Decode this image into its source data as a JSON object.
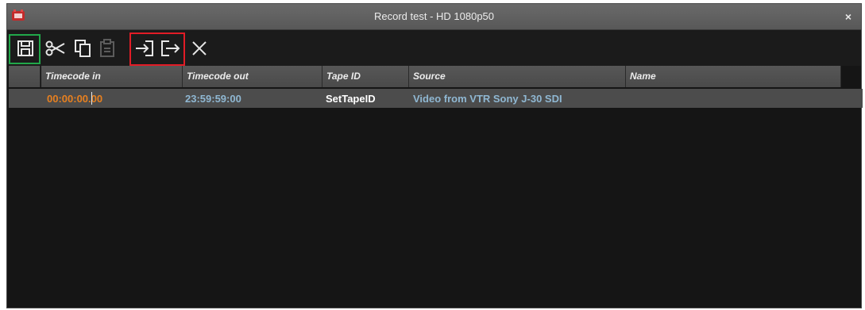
{
  "window": {
    "title": "Record test - HD 1080p50",
    "close_label": "×"
  },
  "toolbar": {
    "buttons": [
      {
        "icon": "save-icon"
      },
      {
        "icon": "cut-icon"
      },
      {
        "icon": "copy-icon"
      },
      {
        "icon": "paste-icon"
      },
      {
        "icon": "mark-in-icon"
      },
      {
        "icon": "mark-out-icon"
      },
      {
        "icon": "delete-icon"
      }
    ]
  },
  "table": {
    "columns": [
      "",
      "Timecode in",
      "Timecode out",
      "Tape ID",
      "Source",
      "Name"
    ],
    "rows": [
      {
        "timecode_in": "00:00:00.00",
        "timecode_out": "23:59:59:00",
        "tape_id": "SetTapeID",
        "source": "Video from VTR Sony J-30 SDI",
        "name": ""
      }
    ]
  },
  "colors": {
    "timecode_in": "#e8801f",
    "timecode_out": "#8fb7d2",
    "tape_id": "#ffffff",
    "source": "#8fb7d2",
    "highlight_green": "#21a84a",
    "highlight_red": "#e21c26"
  }
}
